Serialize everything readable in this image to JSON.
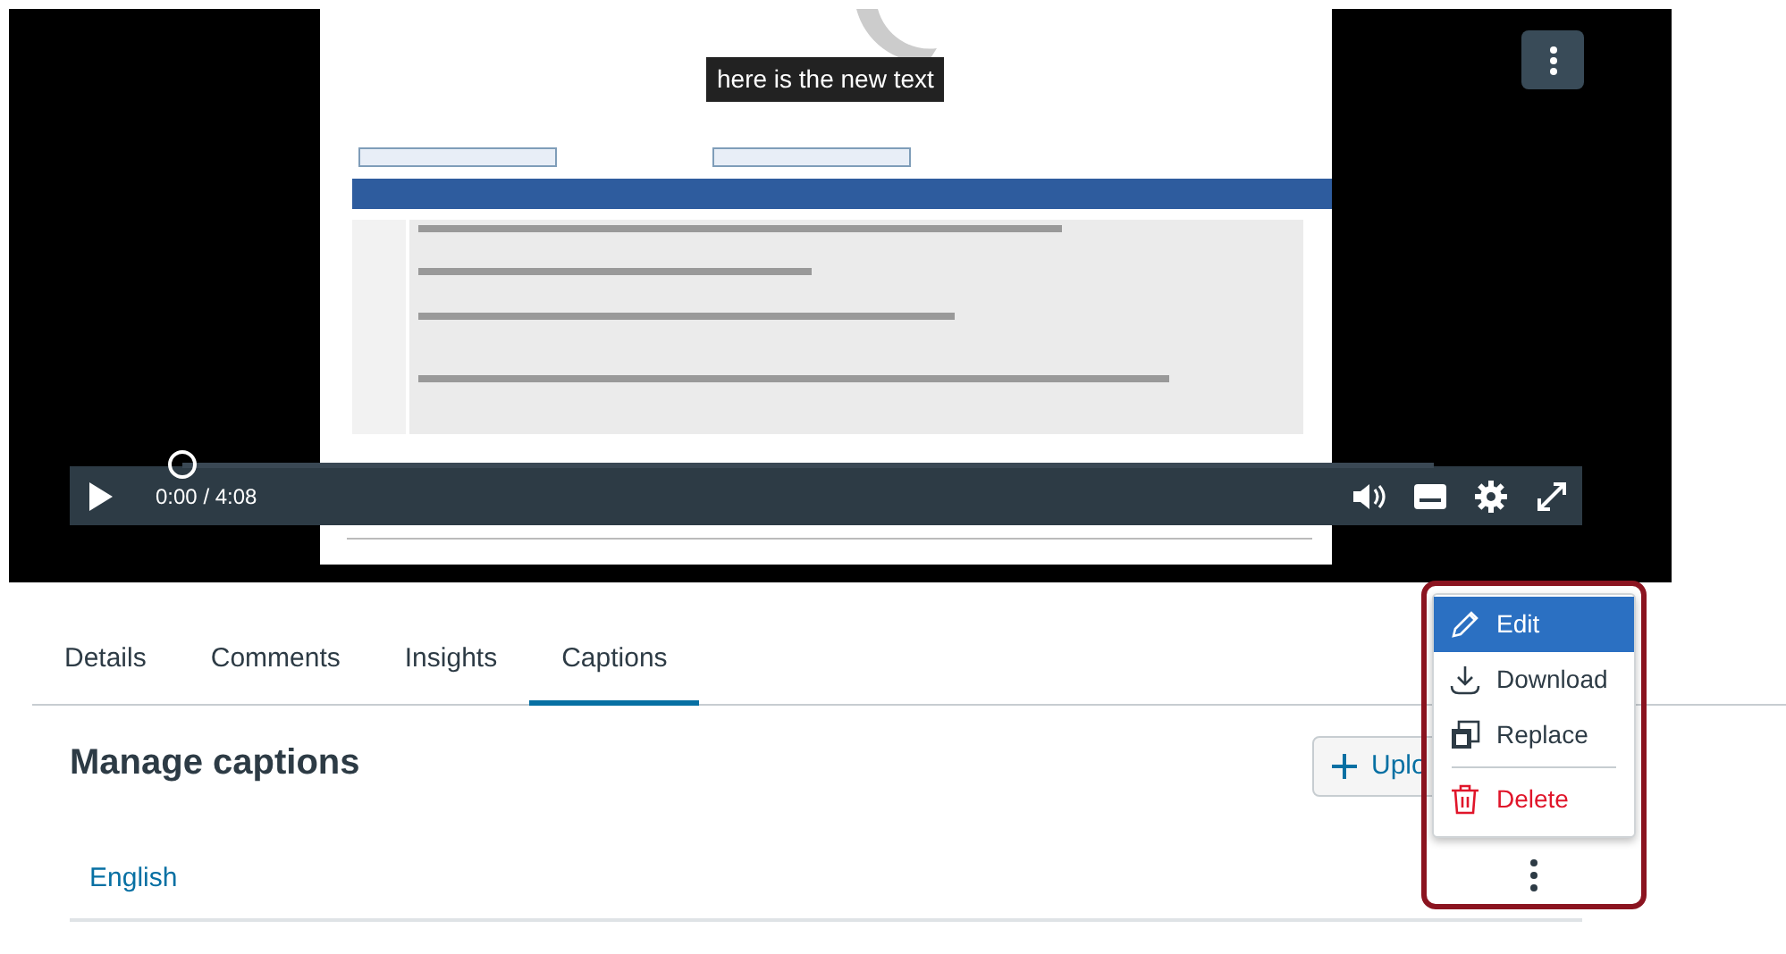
{
  "video": {
    "kind": "picture",
    "caption": "here is the new text",
    "time": "0:00 / 4:08",
    "level": 0
  },
  "tabs": [
    {
      "label": "Details",
      "selected": false
    },
    {
      "label": "Comments",
      "selected": false
    },
    {
      "label": "Insights",
      "selected": false
    },
    {
      "label": "Captions",
      "selected": true
    }
  ],
  "heading": "Manage captions",
  "upload_button": {
    "label": "Uplo"
  },
  "captions": [
    {
      "language": "English"
    }
  ],
  "menu": [
    {
      "label": "Edit",
      "kind": "normal",
      "selected": true
    },
    {
      "label": "Download",
      "kind": "normal",
      "selected": false
    },
    {
      "label": "Replace",
      "kind": "normal",
      "selected": false
    },
    {
      "label": "Delete",
      "kind": "danger",
      "selected": false
    }
  ]
}
